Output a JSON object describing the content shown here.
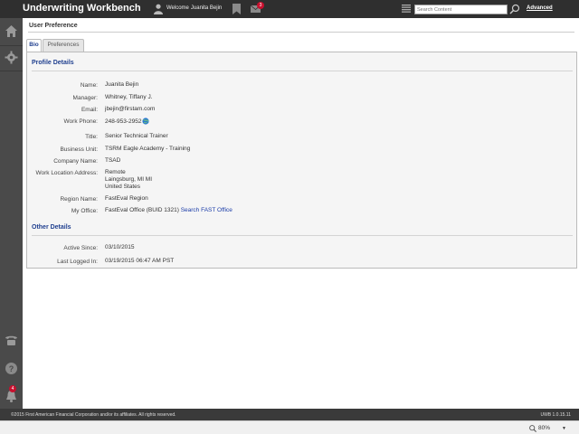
{
  "app": {
    "title": "Underwriting Workbench",
    "welcome_text": "Welcome",
    "user_name": "Juanita Bejin",
    "mail_count": "3",
    "search_placeholder": "Search Content",
    "advanced_label": "Advanced"
  },
  "leftnav": {
    "alert_count": "4",
    "icons": [
      "home-icon",
      "gear-icon",
      "phone-icon",
      "help-icon",
      "bell-icon"
    ]
  },
  "page": {
    "title": "User Preference",
    "tabs": [
      {
        "label": "Bio",
        "active": true
      },
      {
        "label": "Preferences",
        "active": false
      }
    ]
  },
  "profile": {
    "section_title": "Profile Details",
    "fields": {
      "name": {
        "label": "Name:",
        "value": "Juanita Bejin"
      },
      "manager": {
        "label": "Manager:",
        "value": "Whitney, Tiffany J."
      },
      "email": {
        "label": "Email:",
        "value": "jbejin@firstam.com"
      },
      "work_phone": {
        "label": "Work Phone:",
        "value": "248-953-2952"
      },
      "title": {
        "label": "Title:",
        "value": "Senior Technical Trainer"
      },
      "business_unit": {
        "label": "Business Unit:",
        "value": "TSRM Eagle Academy - Training"
      },
      "company_name": {
        "label": "Company Name:",
        "value": "TSAD"
      },
      "work_location": {
        "label": "Work Location Address:",
        "line1": "Remote",
        "line2": "Laingsburg, MI MI",
        "line3": "United States"
      },
      "region_name": {
        "label": "Region Name:",
        "value": "FastEval Region"
      },
      "my_office": {
        "label": "My Office:",
        "value": "FastEval Office (BUID 1321)",
        "link": "Search FAST Office"
      }
    }
  },
  "other": {
    "section_title": "Other Details",
    "fields": {
      "active_since": {
        "label": "Active Since:",
        "value": "03/10/2015"
      },
      "last_logged_in": {
        "label": "Last Logged In:",
        "value": "03/19/2015 06:47 AM PST"
      }
    }
  },
  "footer": {
    "copyright": "©2015 First American Financial Corporation and/or its affiliates. All rights reserved.",
    "version": "UWB 1.0.15.11"
  },
  "statusbar": {
    "zoom": "80%"
  },
  "colors": {
    "topbar": "#2f2f2f",
    "leftnav": "#4a4a4a",
    "accent": "#1f3f8f",
    "badge": "#c8102e"
  }
}
